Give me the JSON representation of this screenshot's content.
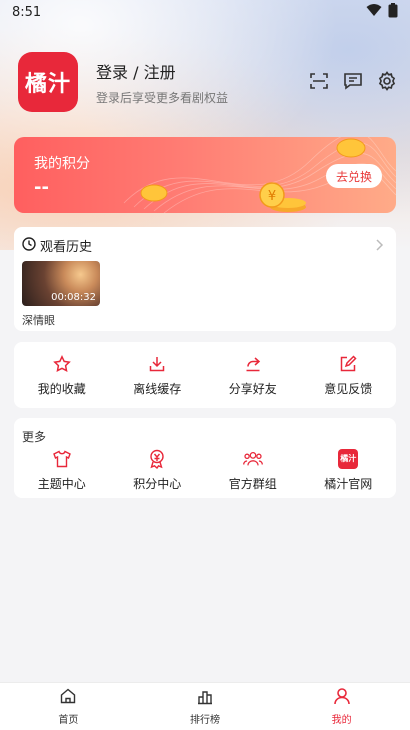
{
  "status_bar": {
    "time": "8:51"
  },
  "profile": {
    "logo_text": "橘汁",
    "login_title": "登录 / 注册",
    "login_subtitle": "登录后享受更多看剧权益"
  },
  "points": {
    "title": "我的积分",
    "value": "--",
    "redeem_label": "去兑换"
  },
  "history": {
    "title": "观看历史",
    "items": [
      {
        "title": "深情眼",
        "duration": "00:08:32"
      }
    ]
  },
  "quick_actions": [
    {
      "label": "我的收藏",
      "icon": "star-icon"
    },
    {
      "label": "离线缓存",
      "icon": "download-icon"
    },
    {
      "label": "分享好友",
      "icon": "share-icon"
    },
    {
      "label": "意见反馈",
      "icon": "edit-icon"
    }
  ],
  "more": {
    "title": "更多",
    "items": [
      {
        "label": "主题中心",
        "icon": "shirt-icon"
      },
      {
        "label": "积分中心",
        "icon": "medal-icon"
      },
      {
        "label": "官方群组",
        "icon": "group-icon"
      },
      {
        "label": "橘汁官网",
        "icon": "app-logo-icon",
        "logo_text": "橘汁"
      }
    ]
  },
  "bottom_nav": [
    {
      "label": "首页",
      "icon": "home-icon"
    },
    {
      "label": "排行榜",
      "icon": "ranking-icon"
    },
    {
      "label": "我的",
      "icon": "person-icon"
    }
  ],
  "colors": {
    "accent": "#e8283a",
    "background": "#f4f4f6"
  }
}
